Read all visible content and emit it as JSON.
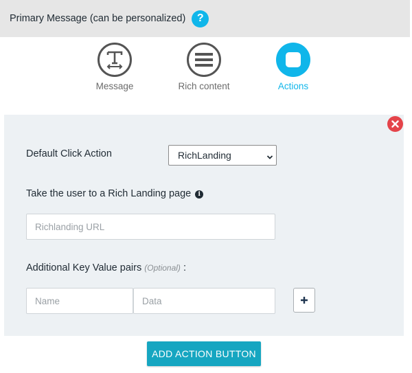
{
  "header": {
    "title": "Primary Message (can be personalized)",
    "help_glyph": "?"
  },
  "tabs": [
    {
      "label": "Message",
      "icon": "text-format-icon",
      "active": false
    },
    {
      "label": "Rich content",
      "icon": "menu-lines-icon",
      "active": false
    },
    {
      "label": "Actions",
      "icon": "square-icon",
      "active": true
    }
  ],
  "panel": {
    "default_click_action_label": "Default Click Action",
    "default_click_action_value": "RichLanding",
    "rich_landing_label": "Take the user to a Rich Landing page",
    "info_glyph": "i",
    "richlanding_url_placeholder": "Richlanding URL",
    "kv_label": "Additional Key Value pairs",
    "kv_optional": "(Optional)",
    "kv_colon": ":",
    "name_placeholder": "Name",
    "data_placeholder": "Data",
    "plus_glyph": "+"
  },
  "add_action_button": "ADD ACTION BUTTON",
  "colors": {
    "accent": "#10b6ea",
    "button": "#16a6c1",
    "close": "#e4444a",
    "panel_bg": "#edf1f4",
    "header_bg": "#e6e6e6"
  }
}
